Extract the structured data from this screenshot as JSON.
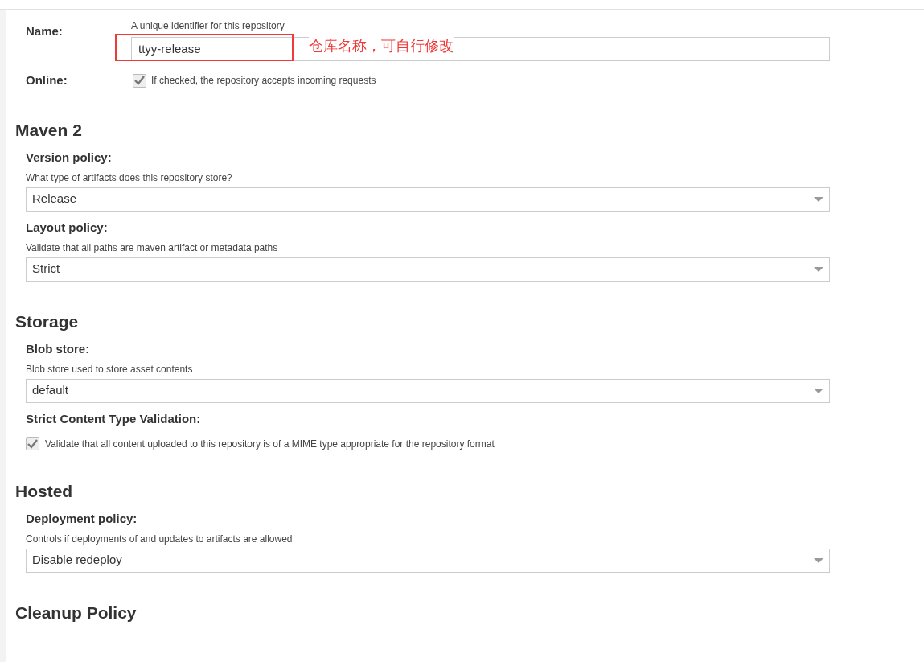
{
  "name_field": {
    "label": "Name:",
    "hint": "A unique identifier for this repository",
    "value": "ttyy-release",
    "annotation": "仓库名称，可自行修改"
  },
  "online": {
    "label": "Online:",
    "checked": true,
    "description": "If checked, the repository accepts incoming requests"
  },
  "sections": [
    {
      "title": "Maven 2",
      "fields": [
        {
          "kind": "select",
          "label": "Version policy:",
          "hint": "What type of artifacts does this repository store?",
          "value": "Release"
        },
        {
          "kind": "select",
          "label": "Layout policy:",
          "hint": "Validate that all paths are maven artifact or metadata paths",
          "value": "Strict"
        }
      ]
    },
    {
      "title": "Storage",
      "fields": [
        {
          "kind": "select",
          "label": "Blob store:",
          "hint": "Blob store used to store asset contents",
          "value": "default"
        },
        {
          "kind": "checkbox",
          "label": "Strict Content Type Validation:",
          "checked": true,
          "description": "Validate that all content uploaded to this repository is of a MIME type appropriate for the repository format"
        }
      ]
    },
    {
      "title": "Hosted",
      "fields": [
        {
          "kind": "select",
          "label": "Deployment policy:",
          "hint": "Controls if deployments of and updates to artifacts are allowed",
          "value": "Disable redeploy"
        }
      ]
    },
    {
      "title": "Cleanup Policy"
    }
  ]
}
